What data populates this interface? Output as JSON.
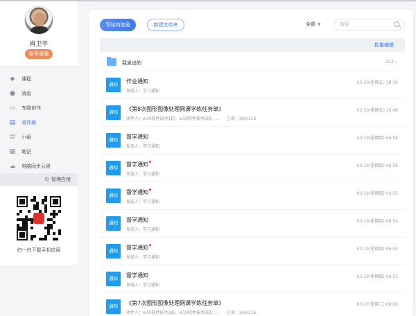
{
  "sidebar": {
    "user_name": "肖卫平",
    "role_badge": "账号管理",
    "nav_items": [
      {
        "label": "课程",
        "icon": "graduation-cap-icon",
        "active": false
      },
      {
        "label": "消息",
        "icon": "chat-bubble-icon",
        "active": false
      },
      {
        "label": "专题创作",
        "icon": "window-icon",
        "active": false
      },
      {
        "label": "收件箱",
        "icon": "inbox-icon",
        "active": true
      },
      {
        "label": "小组",
        "icon": "group-icon",
        "active": false
      },
      {
        "label": "笔记",
        "icon": "note-icon",
        "active": false
      },
      {
        "label": "电脑同步云盘",
        "icon": "cloud-icon",
        "active": false
      }
    ],
    "manage_label": "管理应用",
    "qr_caption": "扫一扫下载手机应用"
  },
  "toolbar": {
    "write_button": "写站内信函",
    "new_folder_button": "新建文件夹",
    "filter_label": "全部",
    "search_placeholder": "搜索"
  },
  "bulk_edit_label": "批量编辑",
  "sent_folder": {
    "label": "我发出的",
    "count": "323"
  },
  "messages": [
    {
      "badge": "通知",
      "title": "作业通知",
      "unread": false,
      "sub": "发送人：学习通知",
      "read": "",
      "time": "03-20(星期五) 18:39"
    },
    {
      "badge": "通知",
      "title": "《第8次图形图像处理网课学练任务单》",
      "unread": false,
      "sub": "收件人：w19软件技术1班、w19软件技术2班、...",
      "read": "已读：100/116",
      "time": "03-20(星期五) 10:48"
    },
    {
      "badge": "通知",
      "title": "督学通知",
      "unread": false,
      "sub": "发送人：学习通知",
      "read": "",
      "time": "03-19(星期四) 06:56"
    },
    {
      "badge": "通知",
      "title": "督学通知",
      "unread": true,
      "sub": "发送人：学习通知",
      "read": "",
      "time": "03-19(星期四) 06:56"
    },
    {
      "badge": "通知",
      "title": "督学通知",
      "unread": true,
      "sub": "发送人：学习通知",
      "read": "",
      "time": "03-19(星期四) 06:55"
    },
    {
      "badge": "通知",
      "title": "督学通知",
      "unread": false,
      "sub": "发送人：学习通知",
      "read": "",
      "time": "03-19(星期四) 06:54"
    },
    {
      "badge": "通知",
      "title": "督学通知",
      "unread": true,
      "sub": "发送人：学习通知",
      "read": "",
      "time": "03-19(星期四) 06:54"
    },
    {
      "badge": "通知",
      "title": "督学通知",
      "unread": false,
      "sub": "发送人：学习通知",
      "read": "",
      "time": "03-19(星期四) 06:53"
    },
    {
      "badge": "通知",
      "title": "《第7次图形图像处理网课学练任务单》",
      "unread": false,
      "sub": "收件人：w19软件技术1班、w19软件技术2班、...",
      "read": "已读：106/116",
      "time": "03-17(星期二) 08:06"
    }
  ]
}
